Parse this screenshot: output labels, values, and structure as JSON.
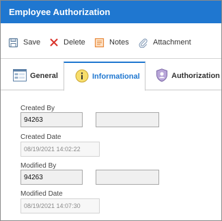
{
  "window": {
    "title": "Employee Authorization"
  },
  "toolbar": {
    "save_label": "Save",
    "delete_label": "Delete",
    "notes_label": "Notes",
    "attachment_label": "Attachment"
  },
  "tabs": [
    {
      "label": "General",
      "icon": "form-icon"
    },
    {
      "label": "Informational",
      "icon": "info-icon"
    },
    {
      "label": "Authorization Co",
      "icon": "shield-user-icon"
    }
  ],
  "fields": {
    "created_by_label": "Created By",
    "created_by_value": "94263",
    "created_by_name": "",
    "created_date_label": "Created Date",
    "created_date_value": "08/19/2021 14:02:22",
    "modified_by_label": "Modified By",
    "modified_by_value": "94263",
    "modified_by_name": "",
    "modified_date_label": "Modified Date",
    "modified_date_value": "08/19/2021 14:07:30"
  },
  "colors": {
    "accent": "#1f77d0",
    "delete": "#d9342b",
    "notes": "#e8893a"
  }
}
